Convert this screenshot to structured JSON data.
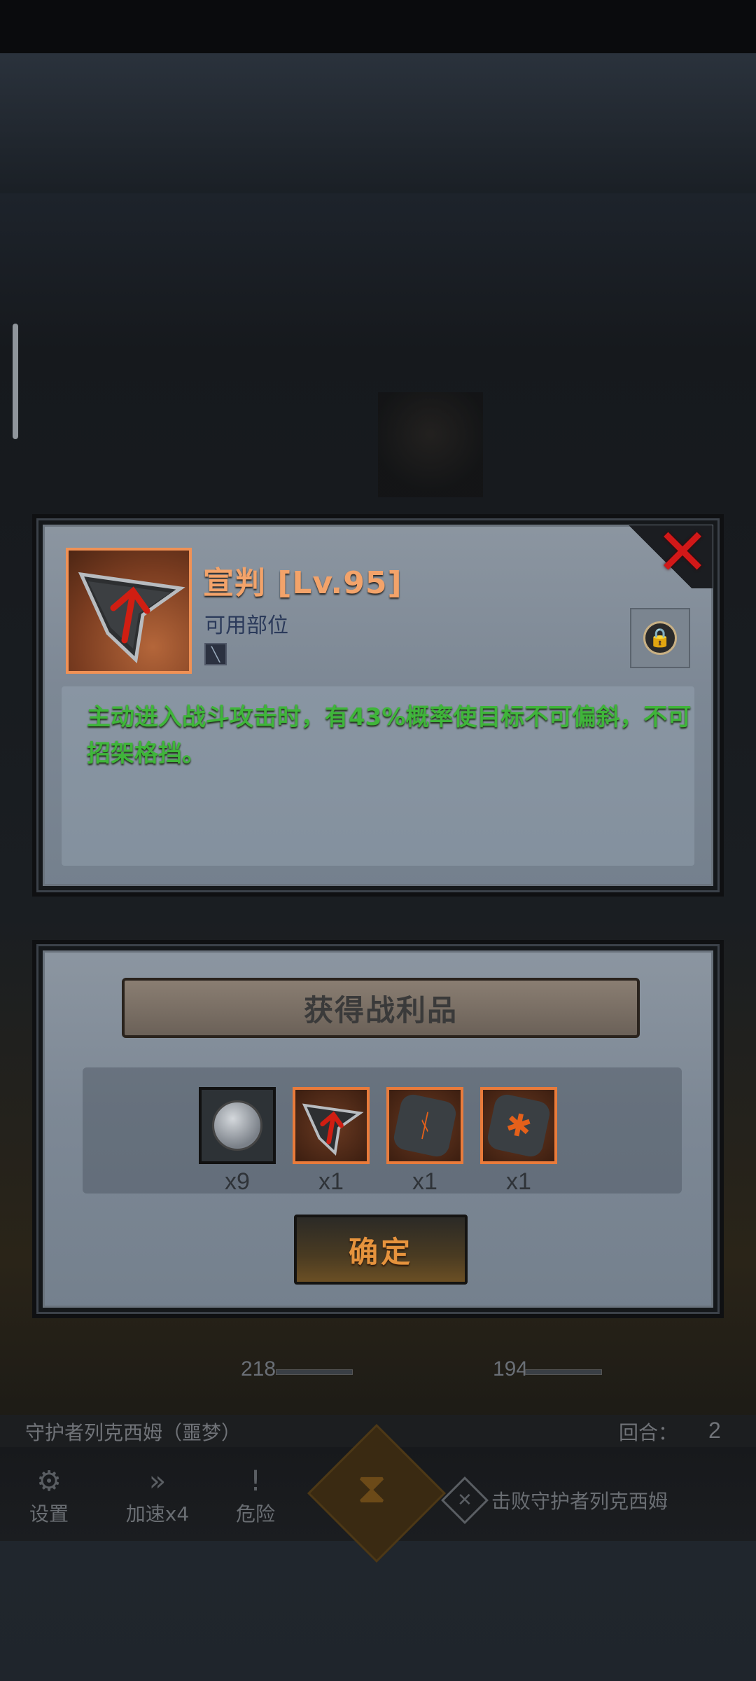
{
  "item": {
    "name": "宣判 [Lv.95]",
    "slot_label": "可用部位",
    "description": "主动进入战斗攻击时，有43%概率使目标不可偏斜，不可招架格挡。",
    "icon": "blade-arrow-icon"
  },
  "loot": {
    "title": "获得战利品",
    "items": [
      {
        "icon": "silver-coin-icon",
        "qty": "x9"
      },
      {
        "icon": "blade-arrow-icon",
        "qty": "x1"
      },
      {
        "icon": "rune-stone-icon",
        "qty": "x1"
      },
      {
        "icon": "rune-stone-icon",
        "qty": "x1"
      }
    ],
    "confirm_label": "确定"
  },
  "battle": {
    "ally_hp": "218",
    "enemy_hp": "194",
    "enemy_name": "守护者列克西姆（噩梦）",
    "round_label": "回合：",
    "round_value": "2",
    "controls": {
      "settings": "设置",
      "speed": "加速x4",
      "danger": "危险"
    },
    "objective": "击败守护者列克西姆"
  },
  "colors": {
    "item_name": "#f3a36a",
    "description": "#3fb53a",
    "close": "#d21818",
    "confirm_text": "#e6933d",
    "rarity_border": "#e97b3b"
  }
}
